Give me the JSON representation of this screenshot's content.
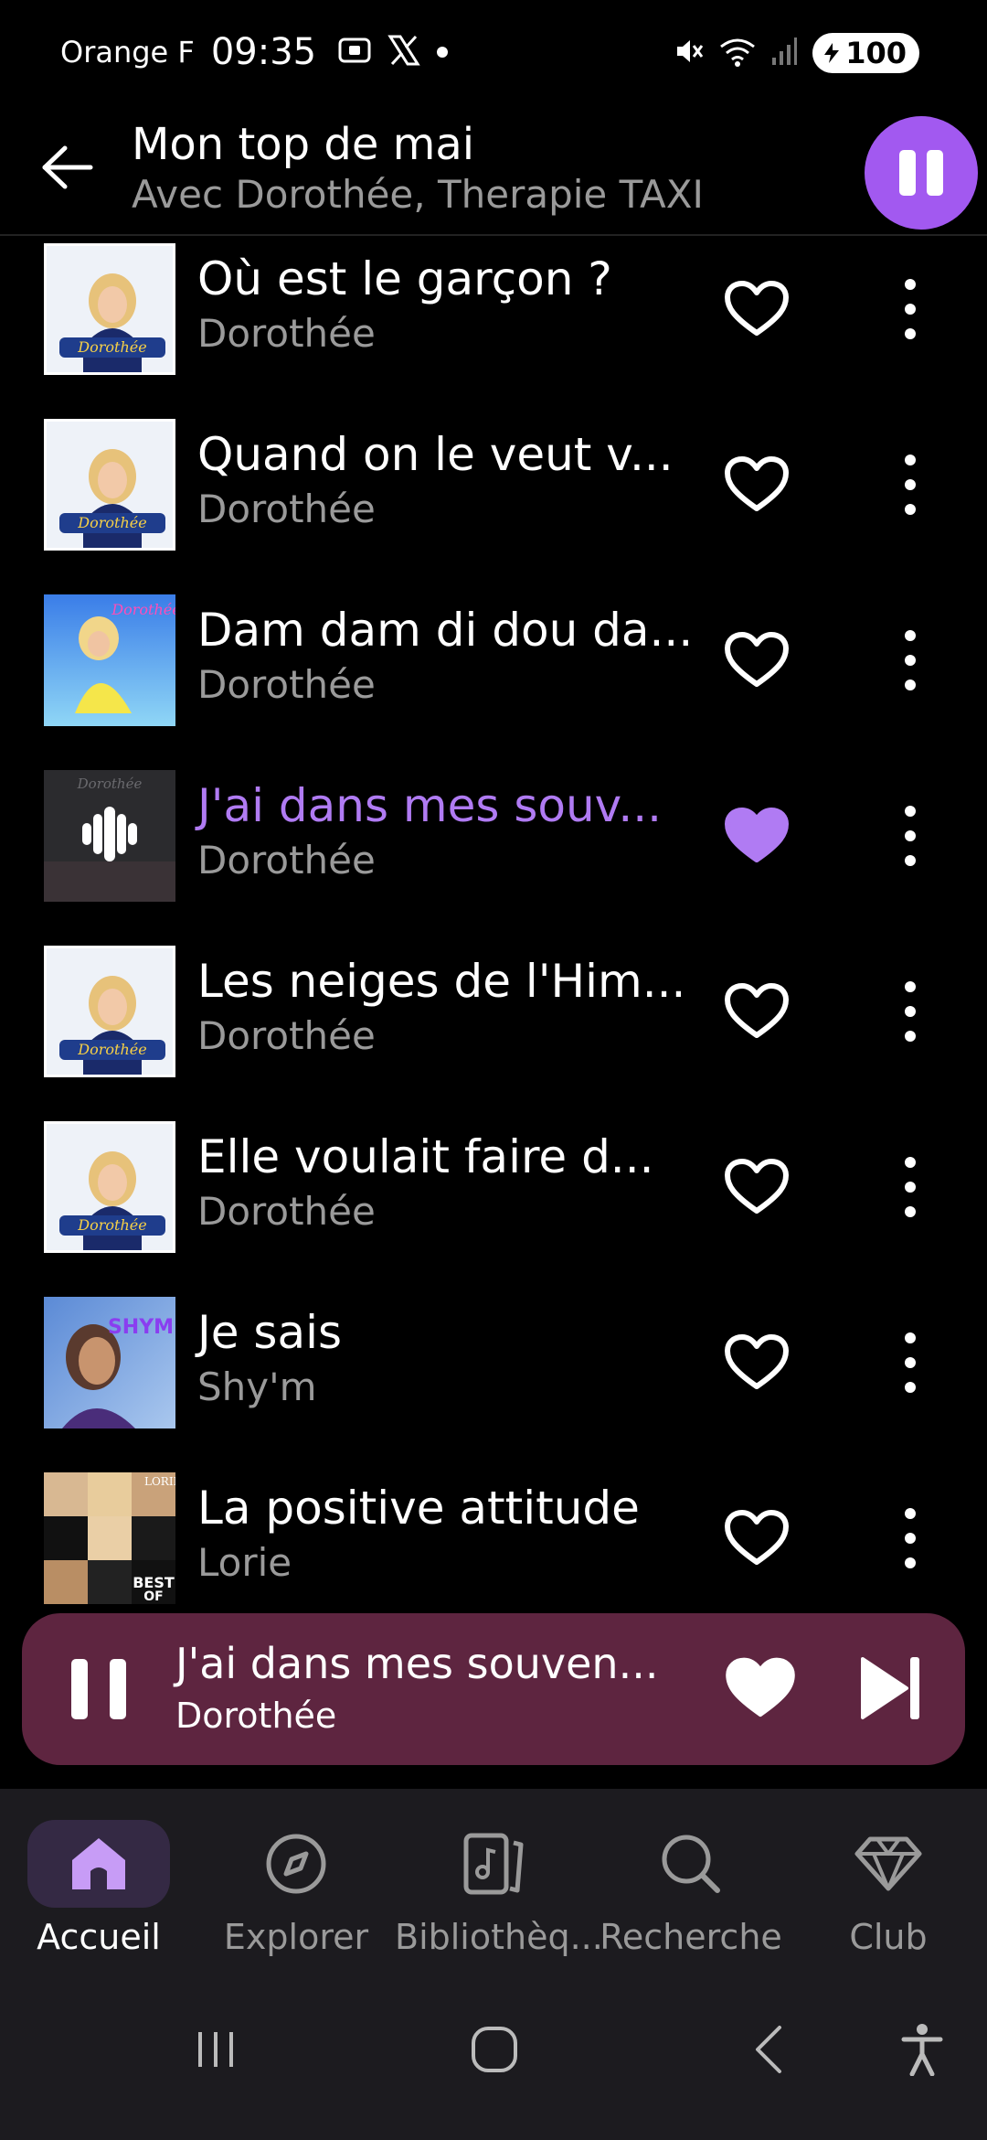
{
  "status_bar": {
    "carrier": "Orange F",
    "time": "09:35",
    "battery": "100",
    "icons": [
      "screenshot-icon",
      "x-icon",
      "notification-dot-icon",
      "mute-icon",
      "wifi-icon",
      "signal-icon",
      "battery-icon"
    ]
  },
  "header": {
    "title": "Mon top de mai",
    "subtitle": "Avec Dorothée, Therapie TAXI",
    "back_icon": "arrow-left-icon",
    "play_state": "playing"
  },
  "tracks": [
    {
      "title": "Où est le garçon ?",
      "artist": "Dorothée",
      "liked": false,
      "active": false,
      "cover": "dorothee-lessentiel"
    },
    {
      "title": "Quand on le veut v...",
      "artist": "Dorothée",
      "liked": false,
      "active": false,
      "cover": "dorothee-lessentiel"
    },
    {
      "title": "Dam dam di dou da...",
      "artist": "Dorothée",
      "liked": false,
      "active": false,
      "cover": "dorothee-blue"
    },
    {
      "title": "J'ai dans mes souv...",
      "artist": "Dorothée",
      "liked": true,
      "active": true,
      "cover": "dorothee-dark"
    },
    {
      "title": "Les neiges de l'Him...",
      "artist": "Dorothée",
      "liked": false,
      "active": false,
      "cover": "dorothee-lessentiel"
    },
    {
      "title": "Elle voulait faire d...",
      "artist": "Dorothée",
      "liked": false,
      "active": false,
      "cover": "dorothee-lessentiel"
    },
    {
      "title": "Je sais",
      "artist": "Shy'm",
      "liked": false,
      "active": false,
      "cover": "shym"
    },
    {
      "title": "La positive attitude",
      "artist": "Lorie",
      "liked": false,
      "active": false,
      "cover": "lorie-best-of"
    }
  ],
  "mini_player": {
    "title": "J'ai dans mes souven...",
    "artist": "Dorothée",
    "liked": true
  },
  "bottom_nav": [
    {
      "label": "Accueil",
      "icon": "home-icon",
      "active": true
    },
    {
      "label": "Explorer",
      "icon": "compass-icon",
      "active": false
    },
    {
      "label": "Bibliothèq...",
      "icon": "library-icon",
      "active": false
    },
    {
      "label": "Recherche",
      "icon": "search-icon",
      "active": false
    },
    {
      "label": "Club",
      "icon": "diamond-icon",
      "active": false
    }
  ],
  "colors": {
    "accent": "#a259f0",
    "active_text": "#b07bf3",
    "mini_player_bg": "#5e2540",
    "nav_bg": "#1c1b1f"
  }
}
